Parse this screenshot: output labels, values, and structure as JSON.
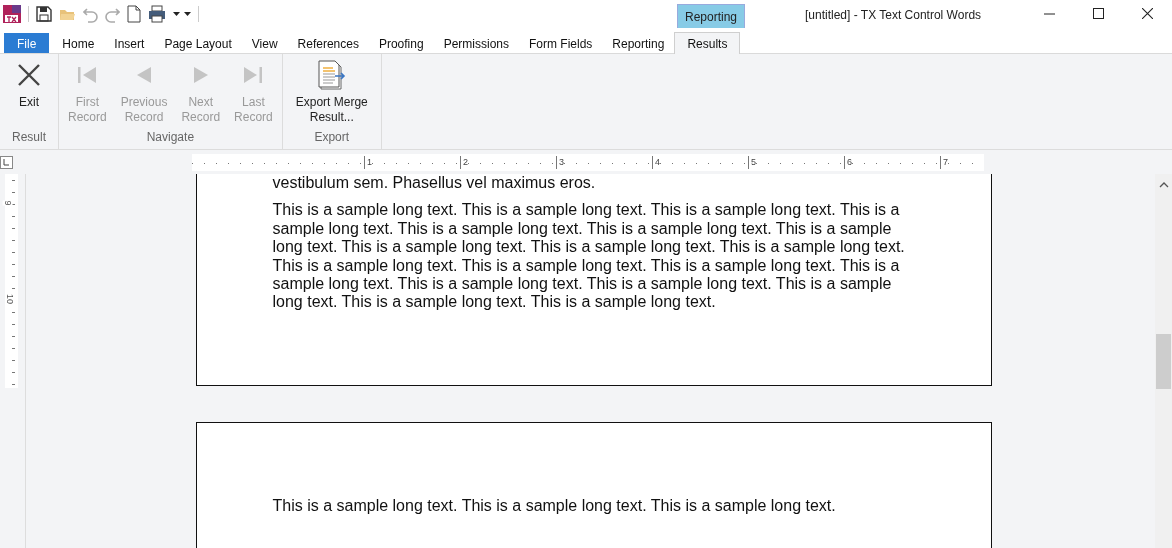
{
  "window": {
    "title": "[untitled] - TX Text Control Words",
    "contextual_tab": "Reporting"
  },
  "tabs": [
    {
      "label": "File",
      "kind": "file",
      "selected": false
    },
    {
      "label": "Home",
      "kind": "tab",
      "selected": false
    },
    {
      "label": "Insert",
      "kind": "tab",
      "selected": false
    },
    {
      "label": "Page Layout",
      "kind": "tab",
      "selected": false
    },
    {
      "label": "View",
      "kind": "tab",
      "selected": false
    },
    {
      "label": "References",
      "kind": "tab",
      "selected": false
    },
    {
      "label": "Proofing",
      "kind": "tab",
      "selected": false
    },
    {
      "label": "Permissions",
      "kind": "tab",
      "selected": false
    },
    {
      "label": "Form Fields",
      "kind": "tab",
      "selected": false
    },
    {
      "label": "Reporting",
      "kind": "tab",
      "selected": false
    },
    {
      "label": "Results",
      "kind": "tab",
      "selected": true
    }
  ],
  "ribbon": {
    "groups": [
      {
        "label": "Result",
        "buttons": [
          {
            "label": "Exit",
            "kind": "exit",
            "disabled": false
          }
        ]
      },
      {
        "label": "Navigate",
        "buttons": [
          {
            "label": "First Record",
            "kind": "first",
            "disabled": true
          },
          {
            "label": "Previous Record",
            "kind": "previous",
            "disabled": true
          },
          {
            "label": "Next Record",
            "kind": "next",
            "disabled": true
          },
          {
            "label": "Last Record",
            "kind": "last",
            "disabled": true
          }
        ]
      },
      {
        "label": "Export",
        "buttons": [
          {
            "label": "Export Merge Result...",
            "kind": "export",
            "disabled": false
          }
        ]
      }
    ]
  },
  "ruler": {
    "horizontal_numbers": [
      "1",
      "2",
      "3",
      "4",
      "5",
      "6",
      "7"
    ],
    "vertical_numbers": [
      "9",
      "10"
    ]
  },
  "document": {
    "pages": [
      {
        "paragraphs": [
          "vestibulum sem. Phasellus vel maximus eros.",
          "This is a sample long text. This is a sample long text. This is a sample long text. This is a sample long text. This is a sample long text. This is a sample long text. This is a sample long text. This is a sample long text. This is a sample long text. This is a sample long text. This is a sample long text. This is a sample long text. This is a sample long text. This is a sample long text. This is a sample long text. This is a sample long text. This is a sample long text. This is a sample long text. This is a sample long text."
        ]
      },
      {
        "paragraphs": [
          "This is a sample long text. This is a sample long text. This is a sample long text."
        ]
      }
    ]
  }
}
